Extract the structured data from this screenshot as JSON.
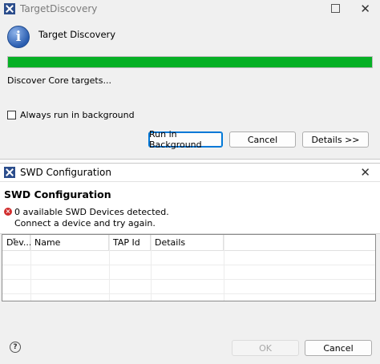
{
  "dialog1": {
    "title": "TargetDiscovery",
    "heading": "Target Discovery",
    "progress": 1.0,
    "status": "Discover Core targets...",
    "checkbox_label": "Always run in background",
    "checkbox_checked": false,
    "buttons": {
      "run_bg": "Run in Background",
      "cancel": "Cancel",
      "details": "Details >>"
    }
  },
  "dialog2": {
    "title": "SWD Configuration",
    "heading": "SWD Configuration",
    "error_line1": "0 available SWD Devices detected.",
    "error_line2": "Connect a device and try again.",
    "table": {
      "columns": [
        "Dev...",
        "Name",
        "TAP Id",
        "Details"
      ],
      "rows": []
    },
    "buttons": {
      "ok": "OK",
      "cancel": "Cancel"
    }
  },
  "colors": {
    "progress": "#06b025",
    "accent": "#0078d7",
    "error": "#d12d2d"
  }
}
